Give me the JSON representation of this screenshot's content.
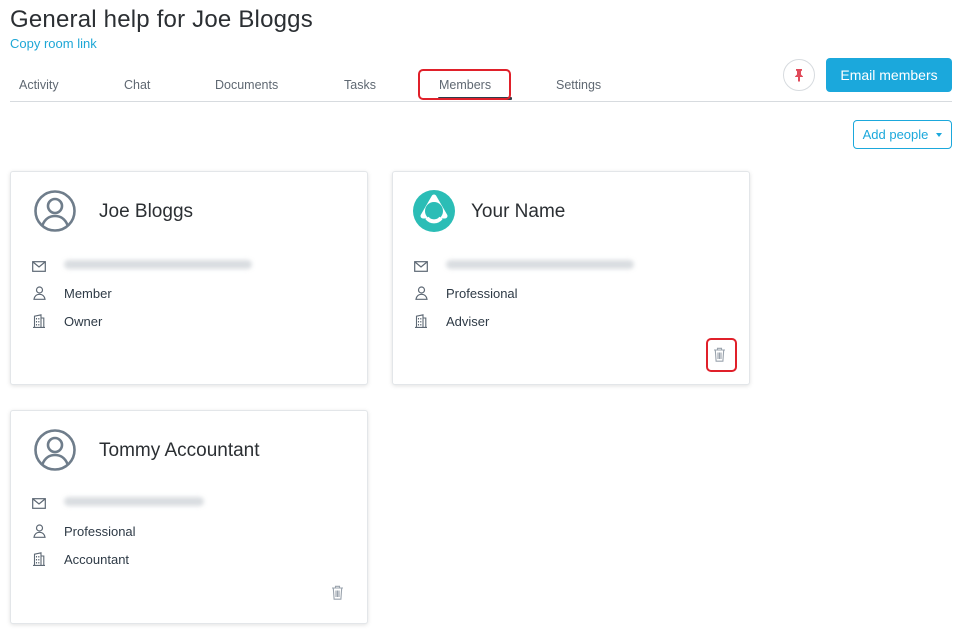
{
  "header": {
    "title": "General help for Joe Bloggs",
    "copy_link_label": "Copy room link"
  },
  "tabs": [
    {
      "label": "Activity"
    },
    {
      "label": "Chat"
    },
    {
      "label": "Documents"
    },
    {
      "label": "Tasks"
    },
    {
      "label": "Members",
      "active": true
    },
    {
      "label": "Settings"
    }
  ],
  "toolbar": {
    "pin_icon": "pin-icon",
    "email_members_label": "Email members",
    "add_people_label": "Add people"
  },
  "members": [
    {
      "name": "Joe Bloggs",
      "email": "",
      "role": "Member",
      "title": "Owner",
      "avatar": "user-circle-icon",
      "deletable": false
    },
    {
      "name": "Your Name",
      "email": "",
      "role": "Professional",
      "title": "Adviser",
      "avatar": "brand-logo-icon",
      "deletable": true
    },
    {
      "name": "Tommy Accountant",
      "email": "",
      "role": "Professional",
      "title": "Accountant",
      "avatar": "user-circle-icon",
      "deletable": true
    }
  ],
  "colors": {
    "accent": "#1ba8dc",
    "highlight": "#e0202a",
    "pin": "#e04a5a",
    "brand_teal": "#2bbdb6"
  }
}
